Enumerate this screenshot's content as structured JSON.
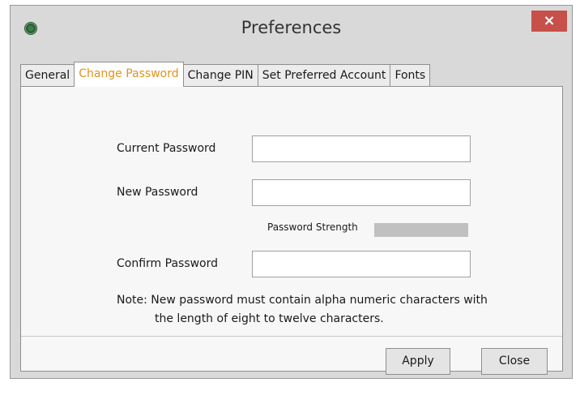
{
  "window": {
    "title": "Preferences",
    "close_glyph": "×"
  },
  "tabs": [
    {
      "label": "General",
      "active": false
    },
    {
      "label": "Change Password",
      "active": true
    },
    {
      "label": "Change PIN",
      "active": false
    },
    {
      "label": "Set Preferred Account",
      "active": false
    },
    {
      "label": "Fonts",
      "active": false
    }
  ],
  "form": {
    "current_password": {
      "label": "Current Password",
      "value": ""
    },
    "new_password": {
      "label": "New Password",
      "value": ""
    },
    "strength": {
      "label": "Password Strength",
      "level": 0
    },
    "confirm_password": {
      "label": "Confirm Password",
      "value": ""
    },
    "note_line1": "Note: New password must contain alpha numeric characters with",
    "note_line2": "the length of eight to twelve characters."
  },
  "buttons": {
    "apply": "Apply",
    "close": "Close"
  },
  "colors": {
    "active_tab_text": "#e3921a",
    "close_button_bg": "#c7504a"
  }
}
